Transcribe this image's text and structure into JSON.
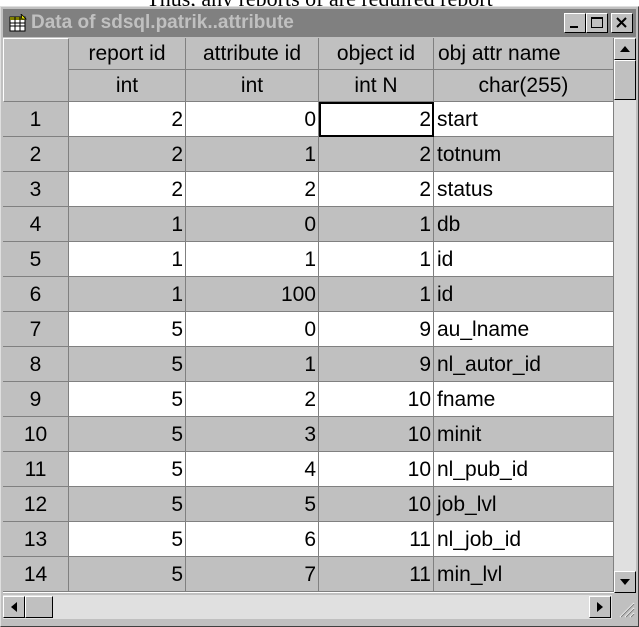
{
  "window": {
    "title": "Data of sdsql.patrik..attribute",
    "minimize_label": "_",
    "maximize_label": "□",
    "close_label": "×"
  },
  "columns": [
    {
      "name": "report  id",
      "type": "int",
      "align": "right"
    },
    {
      "name": "attribute  id",
      "type": "int",
      "align": "right"
    },
    {
      "name": "object  id",
      "type": "int N",
      "align": "right"
    },
    {
      "name": "obj  attr  name",
      "type": "char(255)",
      "align": "left"
    }
  ],
  "rows": [
    {
      "num": "1",
      "cells": [
        "2",
        "0",
        "2",
        "start"
      ]
    },
    {
      "num": "2",
      "cells": [
        "2",
        "1",
        "2",
        "totnum"
      ]
    },
    {
      "num": "3",
      "cells": [
        "2",
        "2",
        "2",
        "status"
      ]
    },
    {
      "num": "4",
      "cells": [
        "1",
        "0",
        "1",
        "db"
      ]
    },
    {
      "num": "5",
      "cells": [
        "1",
        "1",
        "1",
        "id"
      ]
    },
    {
      "num": "6",
      "cells": [
        "1",
        "100",
        "1",
        "id"
      ]
    },
    {
      "num": "7",
      "cells": [
        "5",
        "0",
        "9",
        "au_lname"
      ]
    },
    {
      "num": "8",
      "cells": [
        "5",
        "1",
        "9",
        "nl_autor_id"
      ]
    },
    {
      "num": "9",
      "cells": [
        "5",
        "2",
        "10",
        "fname"
      ]
    },
    {
      "num": "10",
      "cells": [
        "5",
        "3",
        "10",
        "minit"
      ]
    },
    {
      "num": "11",
      "cells": [
        "5",
        "4",
        "10",
        "nl_pub_id"
      ]
    },
    {
      "num": "12",
      "cells": [
        "5",
        "5",
        "10",
        "job_lvl"
      ]
    },
    {
      "num": "13",
      "cells": [
        "5",
        "6",
        "11",
        "nl_job_id"
      ]
    },
    {
      "num": "14",
      "cells": [
        "5",
        "7",
        "11",
        "min_lvl"
      ]
    }
  ],
  "colors": {
    "titlebar": "#808080",
    "face": "#c0c0c0",
    "window": "#ffffff"
  }
}
